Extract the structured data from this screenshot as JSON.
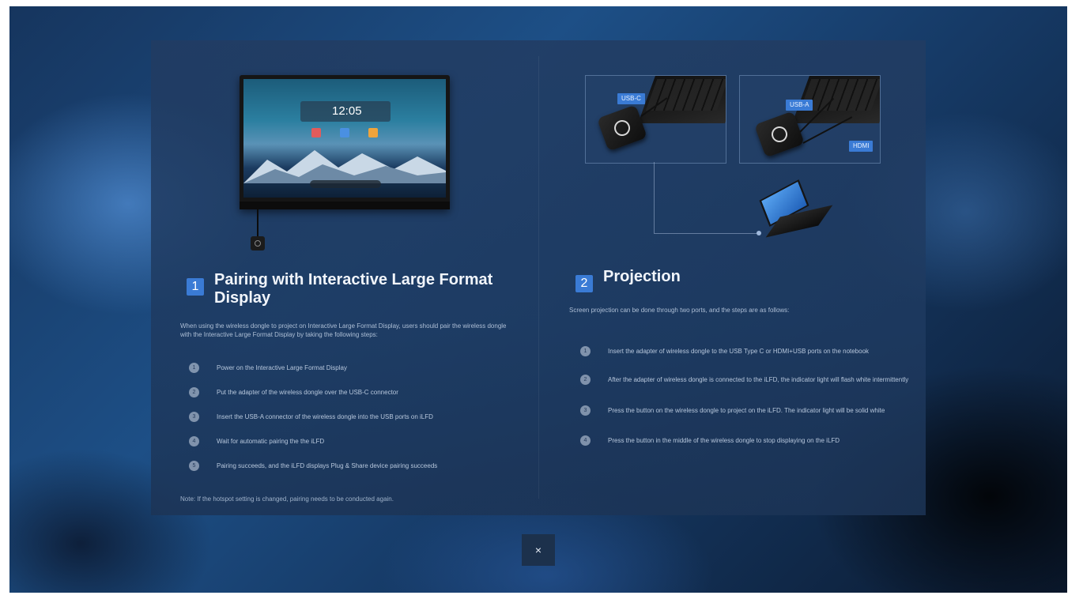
{
  "left": {
    "number": "1",
    "title": "Pairing with Interactive Large Format Display",
    "intro": "When using the wireless dongle to project on Interactive Large Format Display, users should pair the wireless dongle with the Interactive Large Format Display by taking the following steps:",
    "steps": [
      {
        "n": "1",
        "text": "Power on the Interactive Large Format Display"
      },
      {
        "n": "2",
        "text": "Put the adapter of the wireless dongle over the USB-C connector"
      },
      {
        "n": "3",
        "text": "Insert the USB-A connector of the wireless dongle into the USB ports on iLFD"
      },
      {
        "n": "4",
        "text": "Wait for automatic pairing the the iLFD"
      },
      {
        "n": "5",
        "text": "Pairing succeeds, and the iLFD displays Plug & Share device pairing succeeds"
      }
    ],
    "note": "Note: If the hotspot setting is changed, pairing needs to be conducted again.",
    "display_clock": "12:05"
  },
  "right": {
    "number": "2",
    "title": "Projection",
    "intro": "Screen projection can be done through two ports, and the steps are as follows:",
    "ports": {
      "usbc": "USB-C",
      "usba": "USB-A",
      "hdmi": "HDMI"
    },
    "steps": [
      {
        "n": "1",
        "text": "Insert the adapter of wireless dongle to the USB Type C or HDMI+USB ports on the notebook"
      },
      {
        "n": "2",
        "text": "After the adapter of wireless dongle is connected to the iLFD, the indicator light will flash white intermittently"
      },
      {
        "n": "3",
        "text": "Press the button on the wireless dongle to project on the iLFD. The indicator light will be solid white"
      },
      {
        "n": "4",
        "text": "Press the button in the middle of the wireless dongle to stop displaying on the iLFD"
      }
    ]
  },
  "close_label": "×",
  "colors": {
    "accent": "#3a7bd5",
    "panel": "#223c62"
  }
}
